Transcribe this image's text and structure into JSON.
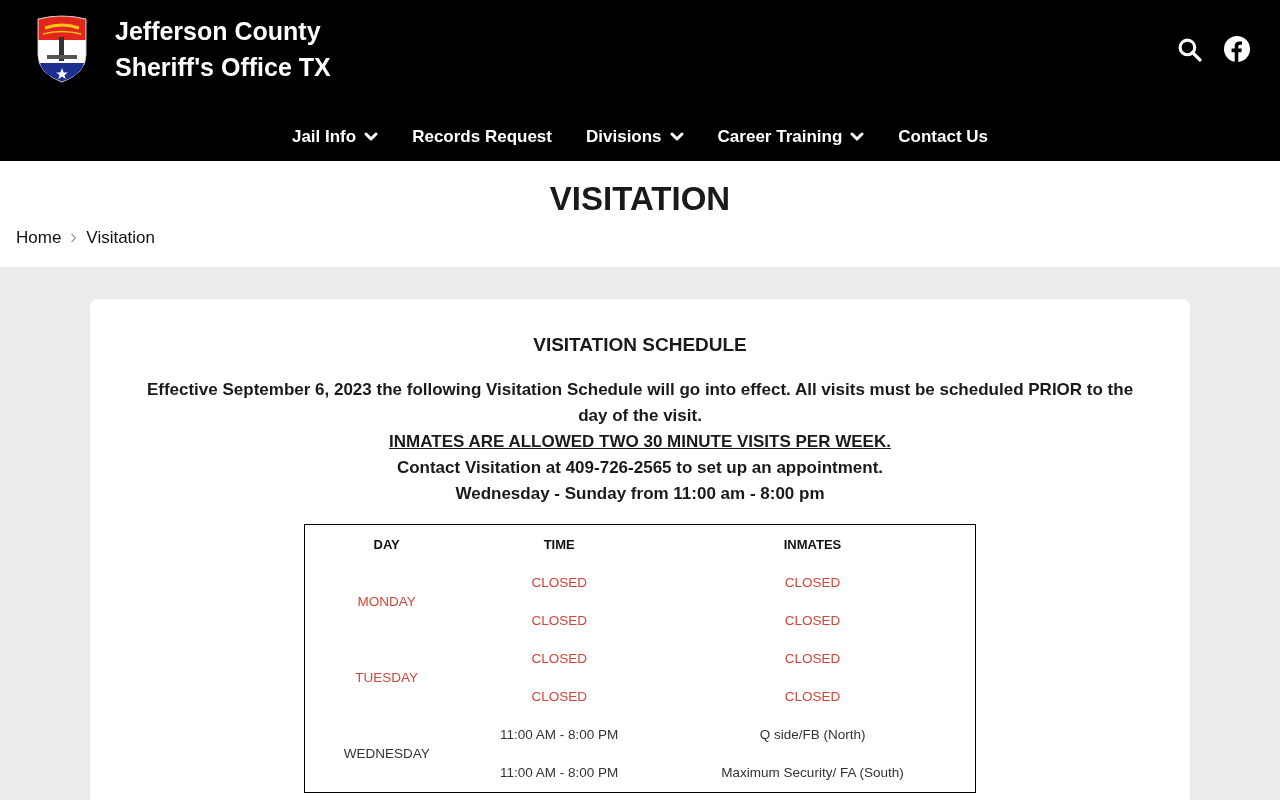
{
  "header": {
    "site_title": "Jefferson County Sheriff's Office TX"
  },
  "nav": [
    {
      "label": "Jail Info",
      "dropdown": true
    },
    {
      "label": "Records Request",
      "dropdown": false
    },
    {
      "label": "Divisions",
      "dropdown": true
    },
    {
      "label": "Career Training",
      "dropdown": true
    },
    {
      "label": "Contact Us",
      "dropdown": false
    }
  ],
  "page_title": "VISITATION",
  "breadcrumb": [
    "Home",
    "Visitation"
  ],
  "content": {
    "heading": "VISITATION SCHEDULE",
    "notice": [
      {
        "text": "Effective September 6, 2023 the following Visitation Schedule will go into effect. All visits must be scheduled PRIOR to the day of the visit.",
        "underlined": false
      },
      {
        "text": "INMATES ARE ALLOWED TWO 30 MINUTE VISITS PER WEEK.",
        "underlined": true
      },
      {
        "text": "Contact Visitation at 409-726-2565 to set up an appointment.",
        "underlined": false
      },
      {
        "text": "Wednesday - Sunday from 11:00 am - 8:00 pm",
        "underlined": false
      }
    ]
  },
  "schedule": {
    "columns": [
      "DAY",
      "TIME",
      "INMATES"
    ],
    "rows": [
      {
        "day": "MONDAY",
        "closed": true,
        "slots": [
          {
            "time": "CLOSED",
            "inmates": "CLOSED"
          },
          {
            "time": "CLOSED",
            "inmates": "CLOSED"
          }
        ]
      },
      {
        "day": "TUESDAY",
        "closed": true,
        "slots": [
          {
            "time": "CLOSED",
            "inmates": "CLOSED"
          },
          {
            "time": "CLOSED",
            "inmates": "CLOSED"
          }
        ]
      },
      {
        "day": "WEDNESDAY",
        "closed": false,
        "slots": [
          {
            "time": "11:00 AM - 8:00 PM",
            "inmates": "Q side/FB (North)"
          },
          {
            "time": "11:00 AM - 8:00 PM",
            "inmates": "Maximum Security/ FA (South)"
          }
        ]
      }
    ]
  }
}
